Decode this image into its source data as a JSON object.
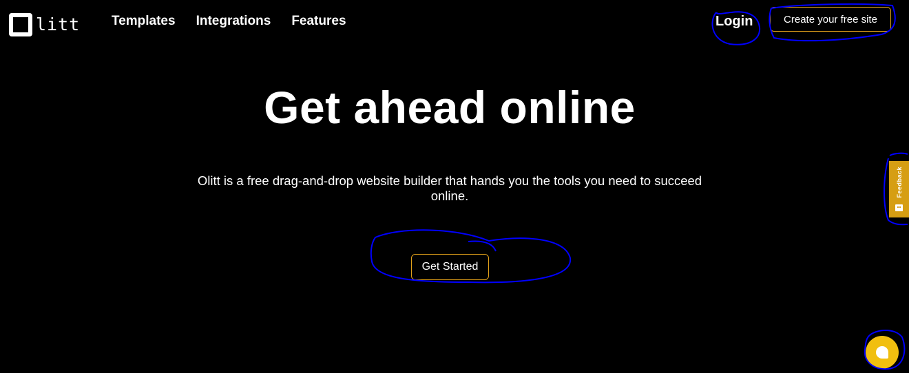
{
  "header": {
    "logo_text": "litt",
    "nav": [
      {
        "label": "Templates"
      },
      {
        "label": "Integrations"
      },
      {
        "label": "Features"
      }
    ],
    "login_label": "Login",
    "cta_label": "Create your free site"
  },
  "hero": {
    "title": "Get ahead online",
    "subtitle": "Olitt is a free drag-and-drop website builder that hands you the tools you need to succeed online.",
    "button_label": "Get Started"
  },
  "feedback": {
    "label": "Feedback",
    "icon": "smiley-face-icon"
  },
  "chat": {
    "icon": "chat-bubble-icon"
  },
  "colors": {
    "accent": "#e2a11a",
    "feedback_bg": "#d69e13",
    "chat_bg": "#f1bf0f",
    "annotation": "#0000ff"
  }
}
